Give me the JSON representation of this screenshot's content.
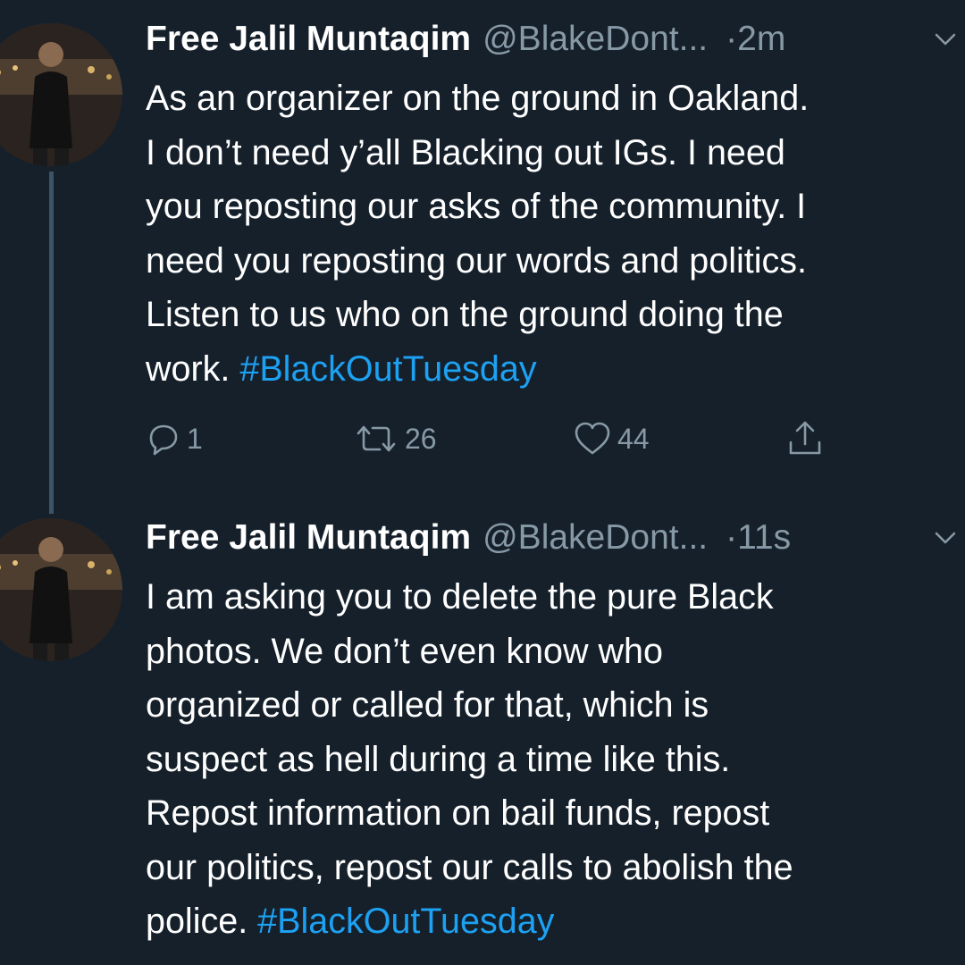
{
  "tweets": [
    {
      "name": "Free Jalil Muntaqim",
      "handle": "@BlakeDont...",
      "separator": "·",
      "time": "2m",
      "text": "As an organizer on the ground in Oakland.\nI don’t need y’all Blacking out IGs. I need\nyou reposting our asks of the community. I\nneed you reposting our words and politics.\nListen to us who on the ground doing the\nwork. ",
      "hashtag": "#BlackOutTuesday",
      "replies": "1",
      "retweets": "26",
      "likes": "44",
      "icons": {
        "reply": "reply-icon",
        "retweet": "retweet-icon",
        "like": "heart-icon",
        "share": "share-icon",
        "menu": "chevron-down-icon"
      }
    },
    {
      "name": "Free Jalil Muntaqim",
      "handle": "@BlakeDont...",
      "separator": "·",
      "time": "11s",
      "text": "I am asking you to delete the pure Black\nphotos. We don’t even know who\norganized or called for that, which is\nsuspect as hell during a time like this.\nRepost information on bail funds, repost\nour politics, repost our calls to abolish the\npolice. ",
      "hashtag": "#BlackOutTuesday",
      "icons": {
        "menu": "chevron-down-icon"
      }
    }
  ],
  "colors": {
    "background": "#15202b",
    "text": "#ffffff",
    "secondary": "#8899a6",
    "link": "#1da1f2",
    "thread_line": "#3d5466"
  }
}
